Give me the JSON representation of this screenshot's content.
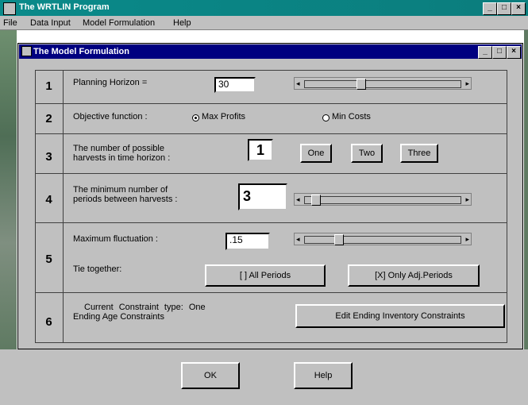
{
  "window": {
    "title": "The WRTLIN Program"
  },
  "menu": {
    "items": [
      "File",
      "Data Input",
      "Model Formulation",
      "Help"
    ]
  },
  "dialog": {
    "title": "The Model Formulation"
  },
  "rows": {
    "r1": {
      "num": "1",
      "label": "Planning Horizon =",
      "value": "30",
      "slider_fraction": 0.35
    },
    "r2": {
      "num": "2",
      "label": "Objective function :",
      "opt1": "Max Profits",
      "opt2": "Min Costs",
      "selected": "Max Profits"
    },
    "r3": {
      "num": "3",
      "label_line1": "The number of possible",
      "label_line2": "harvests in time horizon :",
      "value": "1",
      "btn_one": "One",
      "btn_two": "Two",
      "btn_three": "Three"
    },
    "r4": {
      "num": "4",
      "label_line1": "The minimum number of",
      "label_line2": "periods between harvests :",
      "value": "3",
      "slider_fraction": 0.05
    },
    "r5": {
      "num": "5",
      "label": "Maximum fluctuation :",
      "value": ".15",
      "slider_fraction": 0.2,
      "tie_label": "Tie together:",
      "btn_all": "[ ] All Periods",
      "btn_adj": "[X] Only Adj.Periods"
    },
    "r6": {
      "num": "6",
      "line1": "Current Constraint type: One",
      "line2": "Ending Age Constraints",
      "btn_edit": "Edit Ending Inventory Constraints"
    }
  },
  "footer": {
    "ok": "OK",
    "help": "Help"
  },
  "titlebar_buttons": {
    "min": "_",
    "max": "□",
    "close": "×"
  }
}
